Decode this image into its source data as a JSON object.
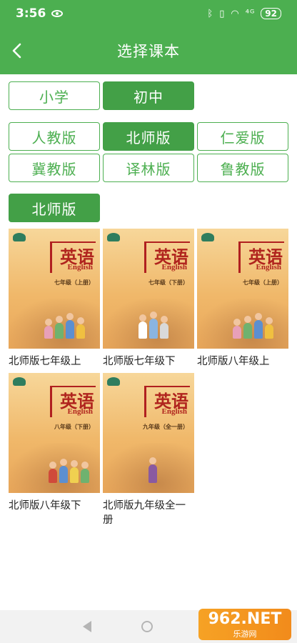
{
  "status_bar": {
    "time": "3:56",
    "signal": "⁴ᴳ",
    "battery": "92"
  },
  "app_bar": {
    "title": "选择课本"
  },
  "stages": [
    {
      "label": "小学",
      "active": false
    },
    {
      "label": "初中",
      "active": true
    }
  ],
  "publishers": [
    {
      "label": "人教版",
      "active": false
    },
    {
      "label": "北师版",
      "active": true
    },
    {
      "label": "仁爱版",
      "active": false
    },
    {
      "label": "冀教版",
      "active": false
    },
    {
      "label": "译林版",
      "active": false
    },
    {
      "label": "鲁教版",
      "active": false
    }
  ],
  "section": {
    "title": "北师版"
  },
  "cover": {
    "title_cn": "英语",
    "title_en": "English"
  },
  "books": [
    {
      "label": "北师版七年级上",
      "grade": "七年级（上册）"
    },
    {
      "label": "北师版七年级下",
      "grade": "七年级（下册）"
    },
    {
      "label": "北师版八年级上",
      "grade": "七年级（上册）"
    },
    {
      "label": "北师版八年级下",
      "grade": "八年级（下册）"
    },
    {
      "label": "北师版九年级全一册",
      "grade": "九年级（全一册）"
    }
  ],
  "watermark": {
    "main": "962.NET",
    "sub": "乐游网"
  },
  "colors": {
    "primary": "#4caf50",
    "active": "#43a047"
  }
}
